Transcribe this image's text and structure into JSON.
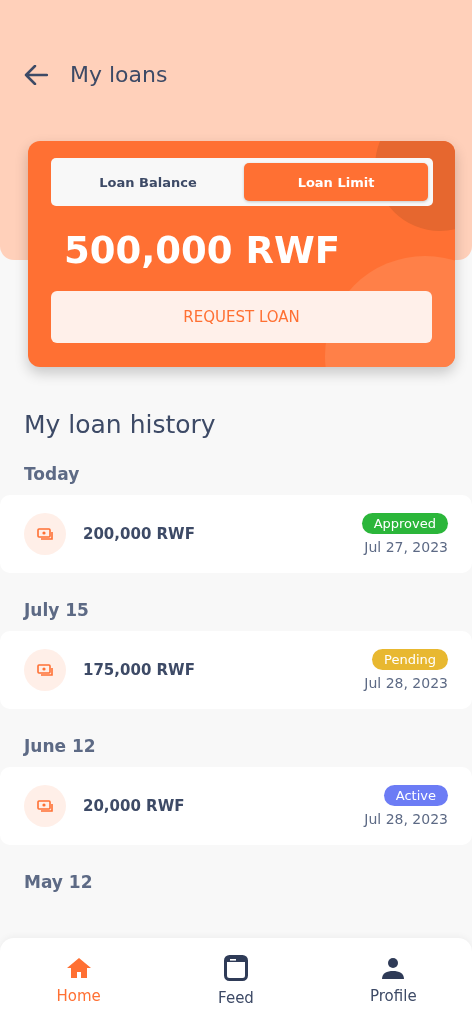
{
  "header": {
    "title": "My loans"
  },
  "card": {
    "tabs": [
      {
        "label": "Loan Balance",
        "selected": false
      },
      {
        "label": "Loan Limit",
        "selected": true
      }
    ],
    "amount": "500,000 RWF",
    "button": "REQUEST LOAN"
  },
  "history": {
    "title": "My loan history",
    "groups": [
      {
        "label": "Today",
        "loans": [
          {
            "amount": "200,000 RWF",
            "status": "Approved",
            "color": "#2bb63a",
            "date": "Jul 27, 2023"
          }
        ]
      },
      {
        "label": "July 15",
        "loans": [
          {
            "amount": "175,000 RWF",
            "status": "Pending",
            "color": "#e8b830",
            "date": "Jul 28, 2023"
          }
        ]
      },
      {
        "label": "June 12",
        "loans": [
          {
            "amount": "20,000 RWF",
            "status": "Active",
            "color": "#6c7cf5",
            "date": "Jul 28, 2023"
          }
        ]
      },
      {
        "label": "May 12"
      }
    ]
  },
  "nav": [
    {
      "label": "Home",
      "kind": "home",
      "selected": true
    },
    {
      "label": "Feed",
      "kind": "feed",
      "selected": false
    },
    {
      "label": "Profile",
      "kind": "profile",
      "selected": false
    }
  ]
}
